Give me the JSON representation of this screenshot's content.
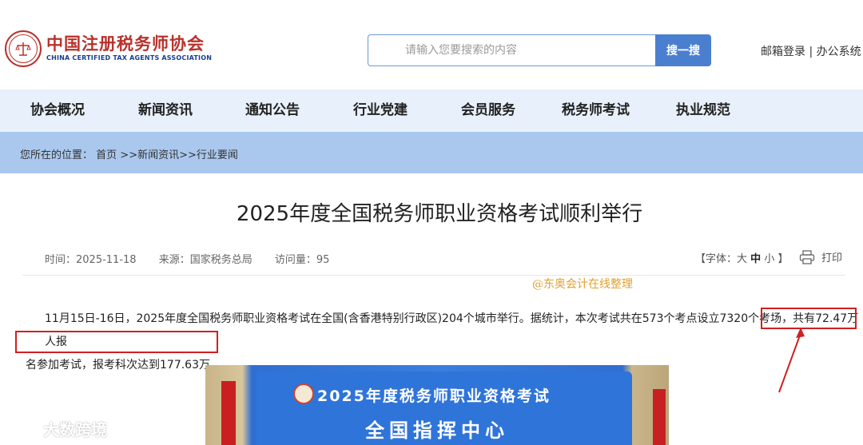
{
  "header": {
    "logo_cn": "中国注册税务师协会",
    "logo_en": "CHINA CERTIFIED TAX AGENTS ASSOCIATION",
    "search_placeholder": "请输入您要搜索的内容",
    "search_button": "搜一搜",
    "link_mail": "邮箱登录",
    "link_sep": " | ",
    "link_office": "办公系统"
  },
  "nav": {
    "items": [
      "协会概况",
      "新闻资讯",
      "通知公告",
      "行业党建",
      "会员服务",
      "税务师考试",
      "执业规范"
    ]
  },
  "breadcrumb": {
    "prefix": "您所在的位置：",
    "home": "首页",
    "sep1": " >>",
    "news": "新闻资讯",
    "sep2": ">>",
    "current": "行业要闻"
  },
  "article": {
    "title": "2025年度全国税务师职业资格考试顺利举行",
    "time": "时间：2025-11-18",
    "source": "来源：国家税务总局",
    "visits": "访问量：95",
    "font_prefix": "【字体：大",
    "font_mid": "中",
    "font_small": "小 】",
    "print": "打印",
    "note": "@东奥会计在线整理",
    "para_line1": "11月15日-16日，2025年度全国税务师职业资格考试在全国(含香港特别行政区)204个城市举行。据统计，本次考试共在573个考点设立7320个考场，共有72.47万人报",
    "para_line2": "名参加考试，报考科次达到177.63万。",
    "photo_line1": "2025年度税务师职业资格考试",
    "photo_line2": "全国指挥中心"
  },
  "watermark": {
    "brand": "大数跨境"
  },
  "colors": {
    "brand_red": "#b8322c",
    "nav_bg": "#e8f0fb",
    "crumb_bg": "#aac8ee",
    "search_btn": "#4a7fd0",
    "highlight": "#d02020"
  }
}
